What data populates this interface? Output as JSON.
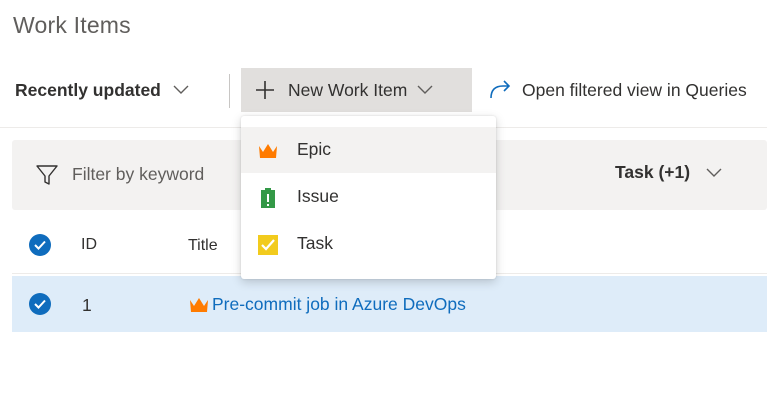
{
  "page": {
    "title": "Work Items"
  },
  "toolbar": {
    "view_selector": "Recently updated",
    "new_item": "New Work Item",
    "open_query": "Open filtered view in Queries"
  },
  "filter": {
    "placeholder": "Filter by keyword",
    "type_filter": "Task (+1)"
  },
  "table": {
    "columns": [
      "ID",
      "Title"
    ],
    "rows": [
      {
        "id": "1",
        "title": "Pre-commit job in Azure DevOps",
        "type": "Epic"
      }
    ]
  },
  "new_item_menu": {
    "items": [
      {
        "label": "Epic",
        "icon": "crown-icon",
        "color": "#ff7b00"
      },
      {
        "label": "Issue",
        "icon": "clipboard-icon",
        "color": "#339947"
      },
      {
        "label": "Task",
        "icon": "checkbox-icon",
        "color": "#f2cb1d"
      }
    ]
  },
  "colors": {
    "accent": "#0f6cbd",
    "selected_row": "#deecf9",
    "epic": "#ff7b00"
  }
}
